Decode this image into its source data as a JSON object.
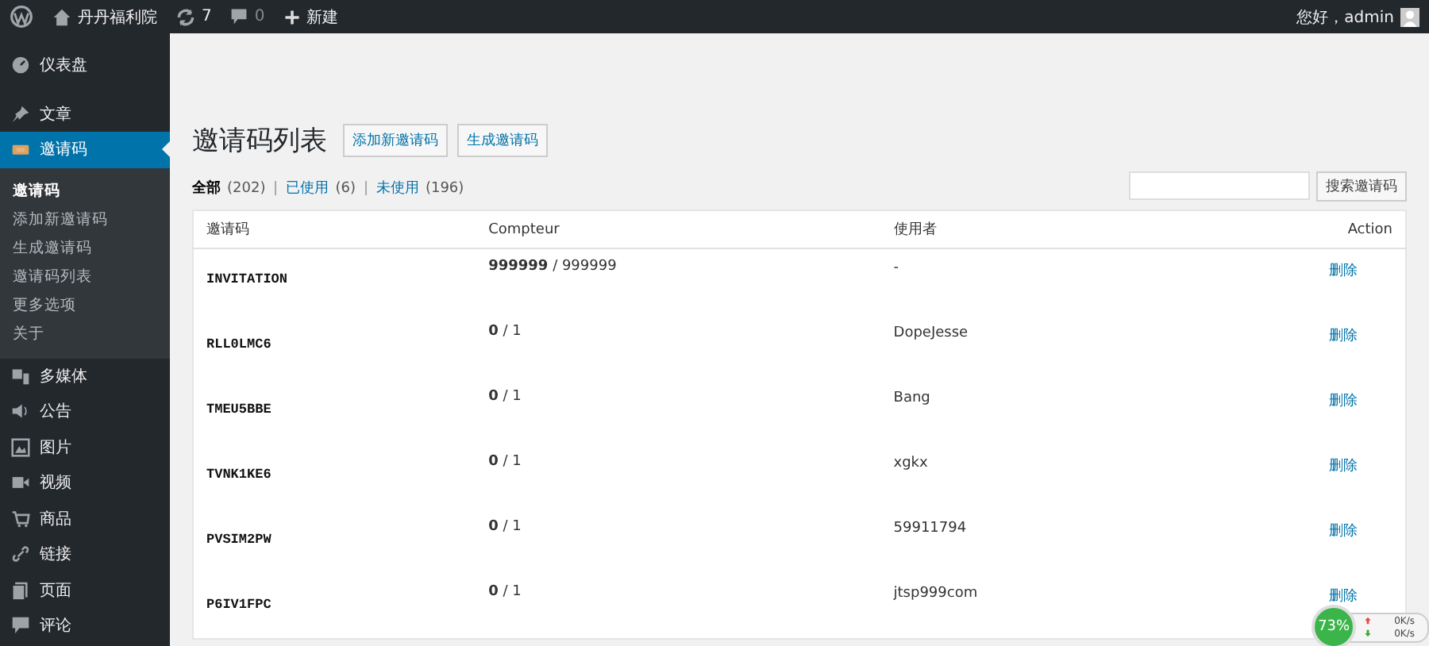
{
  "admin_bar": {
    "site_name": "丹丹福利院",
    "updates": "7",
    "comments": "0",
    "new": "新建",
    "greeting": "您好，admin"
  },
  "sidebar": {
    "items": [
      {
        "label": "仪表盘",
        "selected": false
      },
      {
        "label": "文章",
        "selected": false
      },
      {
        "label": "邀请码",
        "selected": true,
        "children": [
          {
            "label": "邀请码",
            "selected": true
          },
          {
            "label": "添加新邀请码",
            "selected": false
          },
          {
            "label": "生成邀请码",
            "selected": false
          },
          {
            "label": "邀请码列表",
            "selected": false
          },
          {
            "label": "更多选项",
            "selected": false
          },
          {
            "label": "关于",
            "selected": false
          }
        ]
      },
      {
        "label": "多媒体",
        "selected": false
      },
      {
        "label": "公告",
        "selected": false
      },
      {
        "label": "图片",
        "selected": false
      },
      {
        "label": "视频",
        "selected": false
      },
      {
        "label": "商品",
        "selected": false
      },
      {
        "label": "链接",
        "selected": false
      },
      {
        "label": "页面",
        "selected": false
      },
      {
        "label": "评论",
        "selected": false
      }
    ]
  },
  "page": {
    "title": "邀请码列表",
    "buttons": [
      "添加新邀请码",
      "生成邀请码"
    ],
    "filters": [
      {
        "label": "全部",
        "count": "(202)",
        "selected": true
      },
      {
        "label": "已使用",
        "count": "(6)",
        "selected": false
      },
      {
        "label": "未使用",
        "count": "(196)",
        "selected": false
      }
    ],
    "search": {
      "button": "搜索邀请码"
    }
  },
  "table": {
    "columns": [
      "邀请码",
      "Compteur",
      "使用者",
      "Action"
    ],
    "rows": [
      {
        "code": "INVITATION",
        "used": "999999",
        "total": " / 999999",
        "user": "-",
        "action": "删除"
      },
      {
        "code": "RLL0LMC6",
        "used": "0",
        "total": " / 1",
        "user": "DopeJesse",
        "action": "删除"
      },
      {
        "code": "TMEU5BBE",
        "used": "0",
        "total": " / 1",
        "user": "Bang",
        "action": "删除"
      },
      {
        "code": "TVNK1KE6",
        "used": "0",
        "total": " / 1",
        "user": "xgkx",
        "action": "删除"
      },
      {
        "code": "PVSIM2PW",
        "used": "0",
        "total": " / 1",
        "user": "59911794",
        "action": "删除"
      },
      {
        "code": "P6IV1FPC",
        "used": "0",
        "total": " / 1",
        "user": "jtsp999com",
        "action": "删除"
      }
    ]
  },
  "speed_widget": {
    "percent": "73%",
    "upload": "0K/s",
    "download": "0K/s"
  }
}
